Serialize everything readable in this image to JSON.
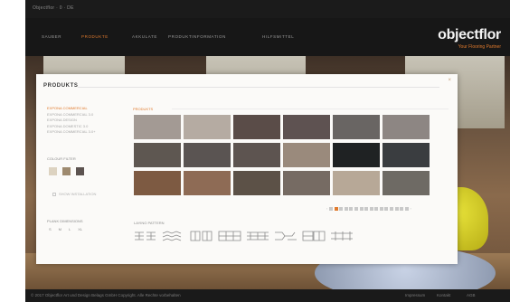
{
  "topbar": {
    "left_label": "Objectflor · 0 · DE",
    "right_label": ""
  },
  "nav": {
    "items": [
      {
        "label": "SAUBER",
        "active": false
      },
      {
        "label": "PRODUKTE",
        "active": true
      },
      {
        "label": "AKKULATE",
        "active": false
      },
      {
        "label": "PRODUKTINFORMATION",
        "active": false
      },
      {
        "label": "HILFSMITTEL",
        "active": false
      }
    ]
  },
  "brand": {
    "name": "objectflor",
    "tagline": "Your Flooring Partner"
  },
  "panel": {
    "title": "PRODUKTS",
    "close_label": "×",
    "breadcrumb": "PRODUKTS",
    "side_items": [
      {
        "label": "EXPONA COMMERCIAL",
        "active": true
      },
      {
        "label": "EXPONA COMMERCIAL 3.0",
        "active": false
      },
      {
        "label": "EXPONA DESIGN",
        "active": false
      },
      {
        "label": "EXPONA DOMESTIC 3.0",
        "active": false
      },
      {
        "label": "EXPONA COMMERCIAL 3.0+",
        "active": false
      }
    ],
    "colour_label": "COLOUR FILTER",
    "colour_swatches": [
      "#ddd3c1",
      "#9e8a6f",
      "#5c5350"
    ],
    "install_label": "SHOW INSTALLATION",
    "size_label": "PLANK DIMENSIONS",
    "size_options": [
      "S",
      "M",
      "L",
      "XL"
    ],
    "pattern_label": "LAYING PATTERN",
    "pattern_names": [
      "herringbone-1",
      "herringbone-2",
      "brick",
      "block",
      "stack",
      "random",
      "basket",
      "parquet"
    ],
    "pager_count": 16,
    "pager_active": 1
  },
  "samples": [
    "#a39a94",
    "#b5aba2",
    "#5a4c48",
    "#5e5251",
    "#696563",
    "#8d8683",
    "#5e5751",
    "#5a5452",
    "#5d5450",
    "#9a8a7c",
    "#1f2223",
    "#3a3d40",
    "#7d5a42",
    "#8e6b55",
    "#5c5147",
    "#766b63",
    "#b7a897",
    "#6e6a64"
  ],
  "footer": {
    "left": "© 2017 Objectflor Art und Design Belags GmbH Copyright. Alle Rechte vorbehalten",
    "links": [
      "Impressum",
      "Kontakt",
      "AGB"
    ]
  }
}
